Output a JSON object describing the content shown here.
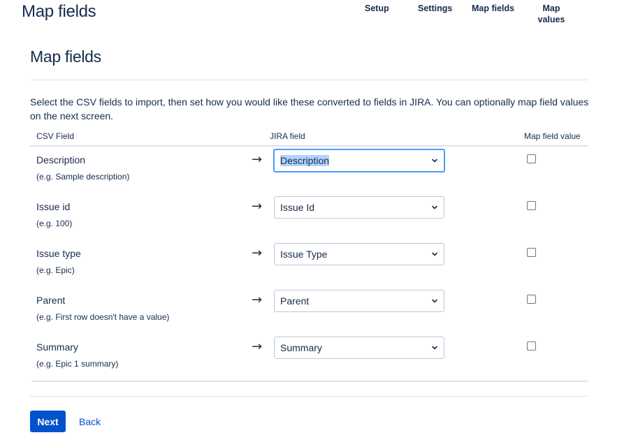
{
  "header": {
    "title": "Map fields",
    "steps": [
      "Setup",
      "Settings",
      "Map fields",
      "Map values"
    ]
  },
  "main": {
    "title": "Map fields",
    "intro": "Select the CSV fields to import, then set how you would like these converted to fields in JIRA. You can optionally map field values on the next screen.",
    "columns": {
      "csv": "CSV Field",
      "jira": "JIRA field",
      "map": "Map field value"
    },
    "rows": [
      {
        "name": "Description",
        "example": "(e.g. Sample description)",
        "jira": "Description",
        "checked": false
      },
      {
        "name": "Issue id",
        "example": "(e.g. 100)",
        "jira": "Issue Id",
        "checked": false
      },
      {
        "name": "Issue type",
        "example": "(e.g. Epic)",
        "jira": "Issue Type",
        "checked": false
      },
      {
        "name": "Parent",
        "example": "(e.g. First row doesn't have a value)",
        "jira": "Parent",
        "checked": false
      },
      {
        "name": "Summary",
        "example": "(e.g. Epic 1 summary)",
        "jira": "Summary",
        "checked": false
      }
    ],
    "arrow_glyph": "→"
  },
  "footer": {
    "next_label": "Next",
    "back_label": "Back"
  },
  "colors": {
    "primary": "#0052cc",
    "text": "#172b4d",
    "focus": "#4c9aff"
  }
}
